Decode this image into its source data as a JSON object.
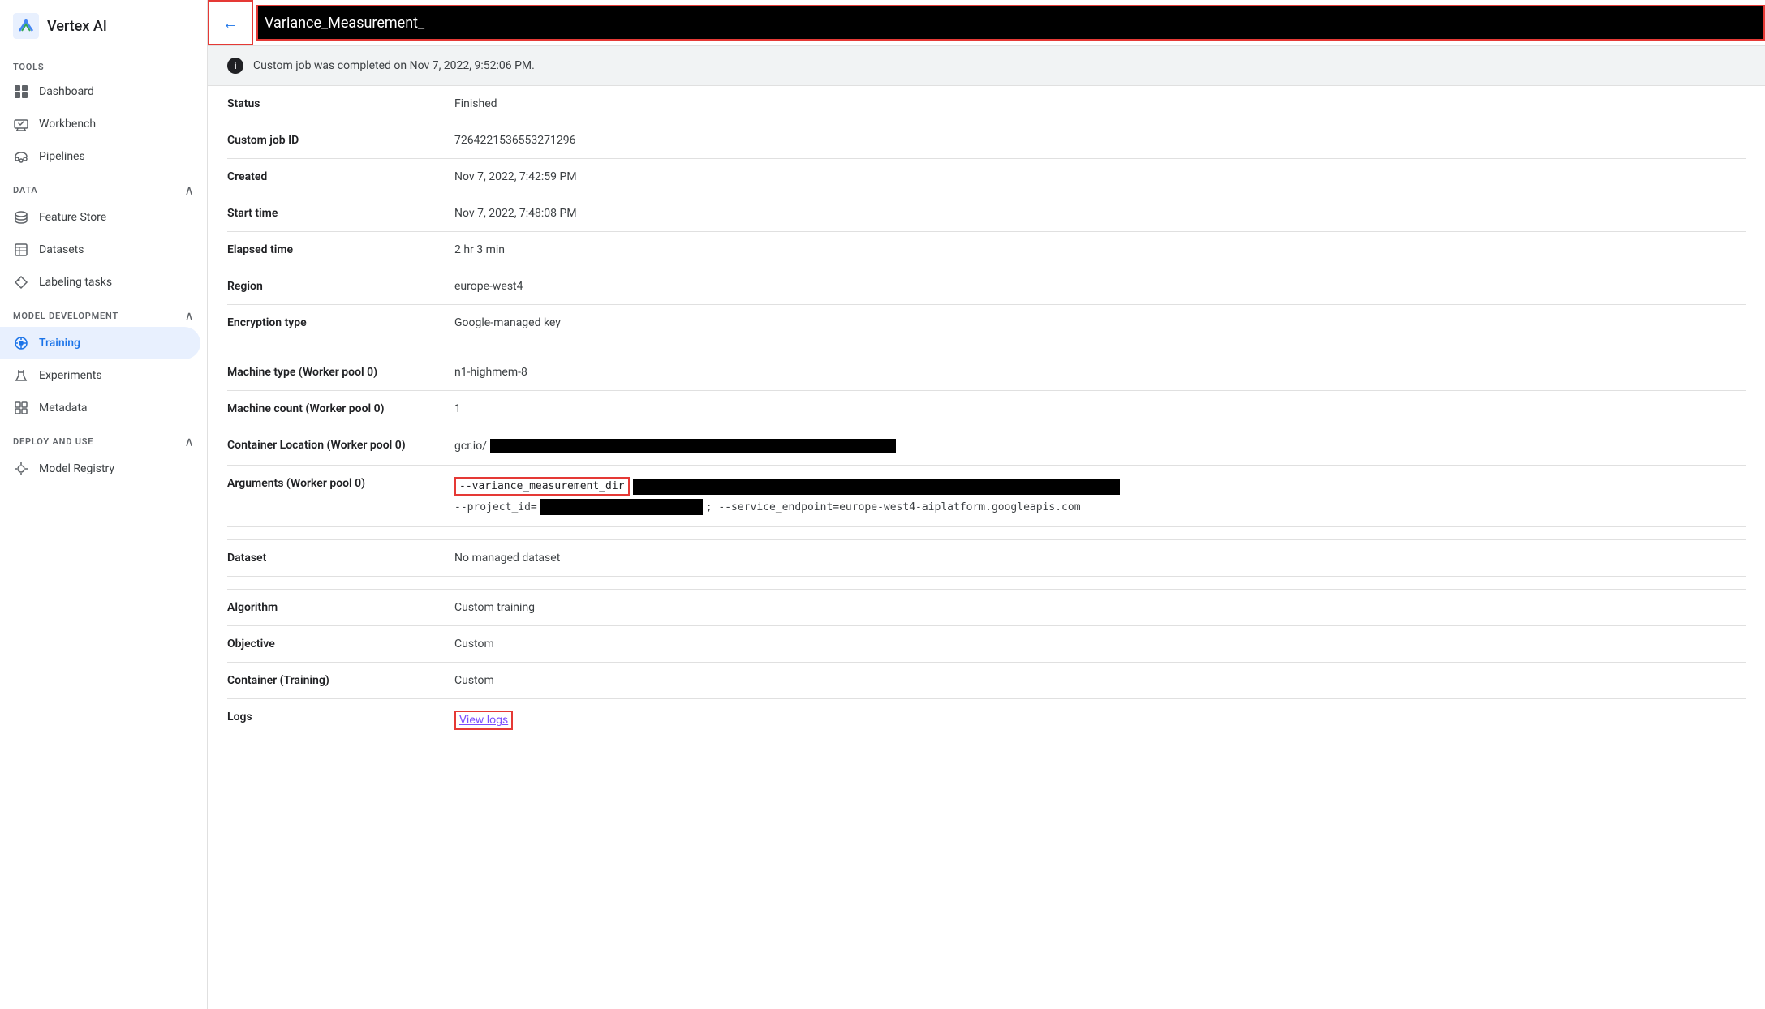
{
  "sidebar": {
    "logo_text": "Vertex AI",
    "tools_label": "TOOLS",
    "items_tools": [
      {
        "label": "Dashboard",
        "icon": "dashboard",
        "active": false
      },
      {
        "label": "Workbench",
        "icon": "workbench",
        "active": false
      },
      {
        "label": "Pipelines",
        "icon": "pipelines",
        "active": false
      }
    ],
    "data_label": "DATA",
    "items_data": [
      {
        "label": "Feature Store",
        "icon": "feature-store",
        "active": false
      },
      {
        "label": "Datasets",
        "icon": "datasets",
        "active": false
      },
      {
        "label": "Labeling tasks",
        "icon": "labeling",
        "active": false
      }
    ],
    "model_dev_label": "MODEL DEVELOPMENT",
    "items_model": [
      {
        "label": "Training",
        "icon": "training",
        "active": true
      },
      {
        "label": "Experiments",
        "icon": "experiments",
        "active": false
      },
      {
        "label": "Metadata",
        "icon": "metadata",
        "active": false
      }
    ],
    "deploy_label": "DEPLOY AND USE",
    "items_deploy": [
      {
        "label": "Model Registry",
        "icon": "model-registry",
        "active": false
      }
    ]
  },
  "topbar": {
    "back_label": "←",
    "title": "Variance_Measurement_"
  },
  "banner": {
    "text": "Custom job was completed on Nov 7, 2022, 9:52:06 PM."
  },
  "details": {
    "status_label": "Status",
    "status_value": "Finished",
    "job_id_label": "Custom job ID",
    "job_id_value": "7264221536553271296",
    "created_label": "Created",
    "created_value": "Nov 7, 2022, 7:42:59 PM",
    "start_time_label": "Start time",
    "start_time_value": "Nov 7, 2022, 7:48:08 PM",
    "elapsed_label": "Elapsed time",
    "elapsed_value": "2 hr 3 min",
    "region_label": "Region",
    "region_value": "europe-west4",
    "encryption_label": "Encryption type",
    "encryption_value": "Google-managed key",
    "machine_type_label": "Machine type (Worker pool 0)",
    "machine_type_value": "n1-highmem-8",
    "machine_count_label": "Machine count (Worker pool 0)",
    "machine_count_value": "1",
    "container_loc_label": "Container Location (Worker pool 0)",
    "container_loc_prefix": "gcr.io/",
    "args_label": "Arguments (Worker pool 0)",
    "args_arg1": "--variance_measurement_dir",
    "args_line2": "--project_id=",
    "args_line2_suffix": "; --service_endpoint=europe-west4-aiplatform.googleapis.com",
    "dataset_label": "Dataset",
    "dataset_value": "No managed dataset",
    "algorithm_label": "Algorithm",
    "algorithm_value": "Custom training",
    "objective_label": "Objective",
    "objective_value": "Custom",
    "container_training_label": "Container (Training)",
    "container_training_value": "Custom",
    "logs_label": "Logs",
    "logs_link_text": "View logs"
  }
}
